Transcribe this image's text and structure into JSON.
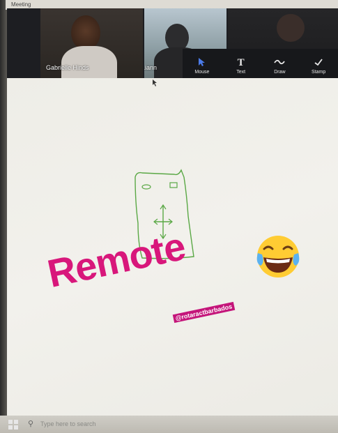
{
  "window": {
    "title": "Meeting"
  },
  "participants": [
    {
      "name": "Gabrielle Hinds"
    },
    {
      "name": "Liann"
    }
  ],
  "toolbar": {
    "items": [
      {
        "label": "Mouse",
        "icon": "mouse-pointer-icon",
        "active": true
      },
      {
        "label": "Text",
        "icon": "text-icon",
        "active": false
      },
      {
        "label": "Draw",
        "icon": "draw-icon",
        "active": false
      },
      {
        "label": "Stamp",
        "icon": "stamp-icon",
        "active": false
      }
    ]
  },
  "overlay": {
    "caption": "Remote",
    "handle": "@rotaractbarbados",
    "emoji": "face-with-tears-of-joy",
    "caption_color": "#d8177b"
  },
  "taskbar": {
    "search_placeholder": "Type here to search"
  },
  "colors": {
    "toolbar_bg": "#17181b",
    "active_tool": "#4b7bea",
    "doodle_stroke": "#5aa845"
  }
}
